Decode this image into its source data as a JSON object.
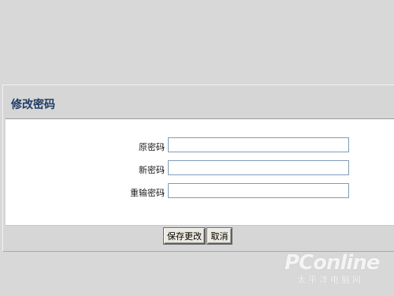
{
  "panel": {
    "title": "修改密码"
  },
  "form": {
    "fields": [
      {
        "label": "原密码",
        "colon": ":",
        "value": ""
      },
      {
        "label": "新密码",
        "colon": ":",
        "value": ""
      },
      {
        "label": "重输密码",
        "colon": ":",
        "value": ""
      }
    ]
  },
  "buttons": {
    "save_label": "保存更改",
    "cancel_label": "取消"
  },
  "watermark": {
    "brand": "PConline",
    "sub": "太平洋电脑网"
  }
}
